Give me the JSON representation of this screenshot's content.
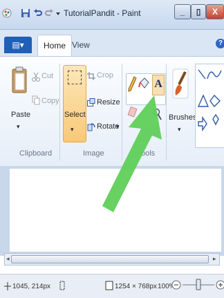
{
  "window": {
    "title": "TutorialPandit - Paint",
    "min_label": "_",
    "max_label": "▯",
    "close_label": "X"
  },
  "tabs": {
    "file_menu": "▤▾",
    "home": "Home",
    "view": "View",
    "help": "?"
  },
  "clipboard": {
    "paste": "Paste",
    "cut": "Cut",
    "copy": "Copy",
    "group": "Clipboard"
  },
  "image": {
    "select": "Select",
    "crop": "Crop",
    "resize": "Resize",
    "rotate": "Rotate",
    "group": "Image"
  },
  "tools": {
    "text_glyph": "A",
    "group": "ools"
  },
  "brushes": {
    "label": "Brushes"
  },
  "status": {
    "cursor_position": "1045, 214px",
    "image_size": "1254 × 768px",
    "zoom": "100%"
  },
  "colors": {
    "accent": "#1f5fb5",
    "select_active": "#f9c878",
    "annotation_arrow": "#5fcf5a",
    "close_button": "#c6412a"
  }
}
